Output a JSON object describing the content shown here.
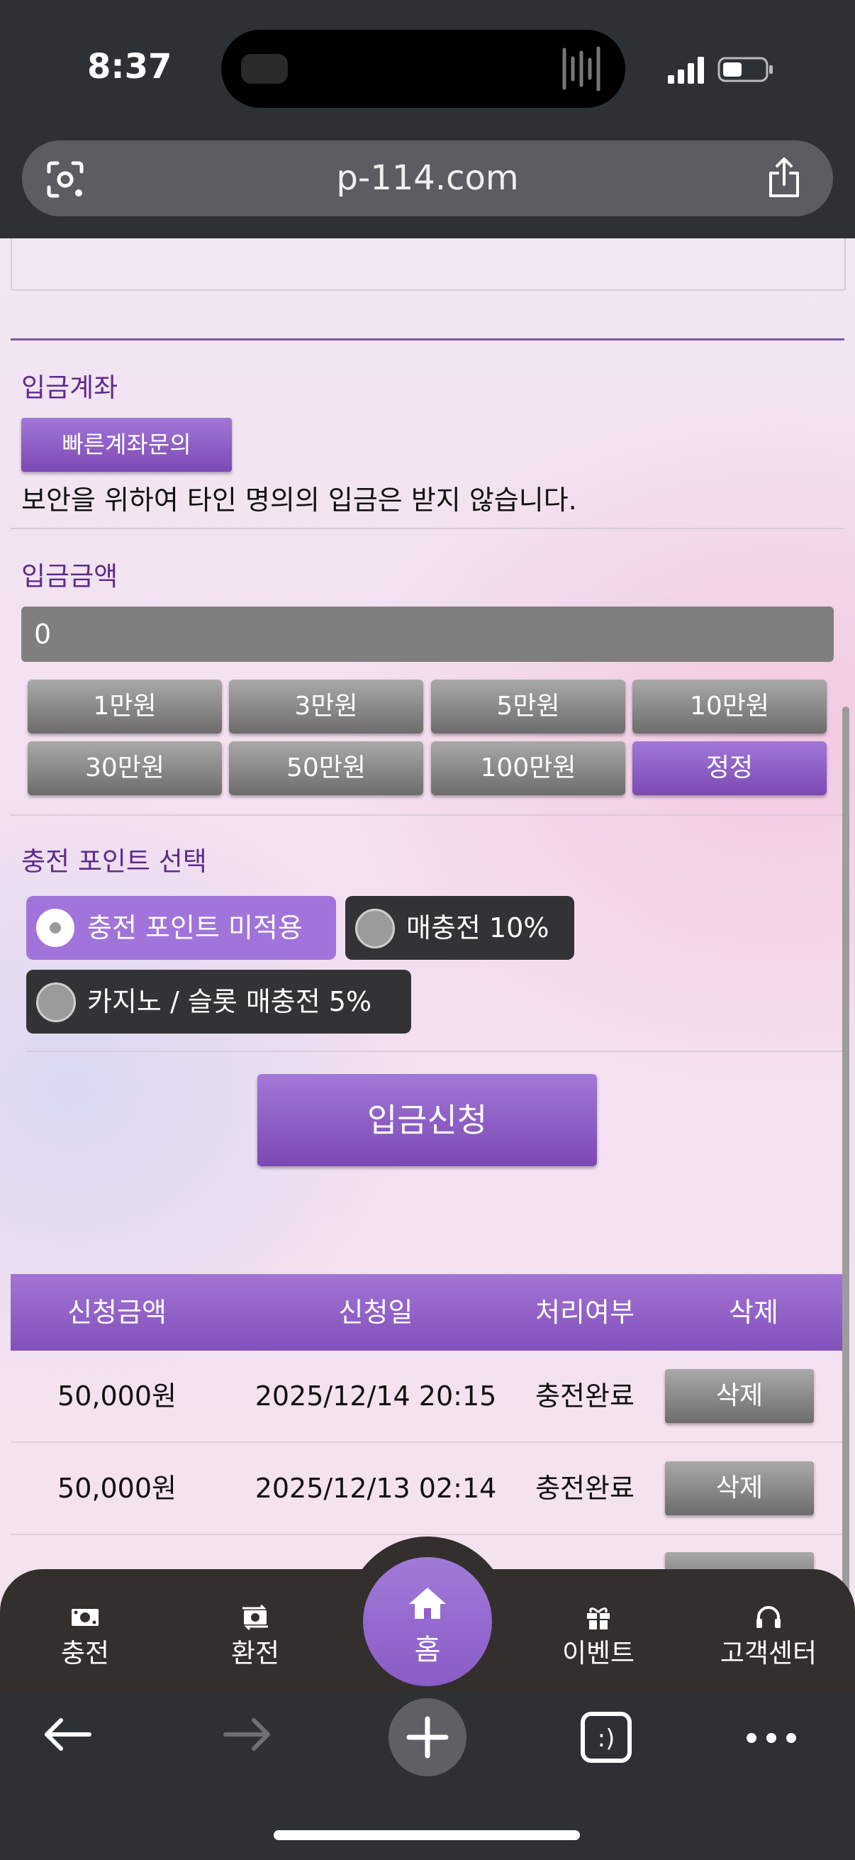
{
  "status_bar": {
    "time": "8:37"
  },
  "browser": {
    "url": "p-114.com"
  },
  "deposit_account": {
    "label": "입금계좌",
    "quick_inquiry_button": "빠른계좌문의",
    "notice": "보안을 위하여 타인 명의의 입금은 받지 않습니다."
  },
  "deposit_amount": {
    "label": "입금금액",
    "input_value": "0",
    "quick_amounts": [
      "1만원",
      "3만원",
      "5만원",
      "10만원",
      "30만원",
      "50만원",
      "100만원"
    ],
    "correct_button": "정정"
  },
  "charge_points": {
    "label": "충전 포인트 선택",
    "options": [
      {
        "label": "충전 포인트 미적용",
        "selected": true
      },
      {
        "label": "매충전 10%",
        "selected": false
      },
      {
        "label": "카지노 / 슬롯 매충전 5%",
        "selected": false
      }
    ]
  },
  "submit_button": "입금신청",
  "history_table": {
    "headers": [
      "신청금액",
      "신청일",
      "처리여부",
      "삭제"
    ],
    "rows": [
      {
        "amount": "50,000원",
        "date": "2025/12/14 20:15",
        "status": "충전완료",
        "delete": "삭제"
      },
      {
        "amount": "50,000원",
        "date": "2025/12/13 02:14",
        "status": "충전완료",
        "delete": "삭제"
      }
    ]
  },
  "site_nav": {
    "items": [
      {
        "label": "충전",
        "icon": "money-icon"
      },
      {
        "label": "환전",
        "icon": "exchange-icon"
      },
      {
        "label": "홈",
        "icon": "home-icon"
      },
      {
        "label": "이벤트",
        "icon": "gift-icon"
      },
      {
        "label": "고객센터",
        "icon": "headset-icon"
      }
    ]
  },
  "colors": {
    "accent": "#8a5cc6",
    "nav_bg": "#332f2c",
    "chrome_bg": "#2e3134"
  }
}
